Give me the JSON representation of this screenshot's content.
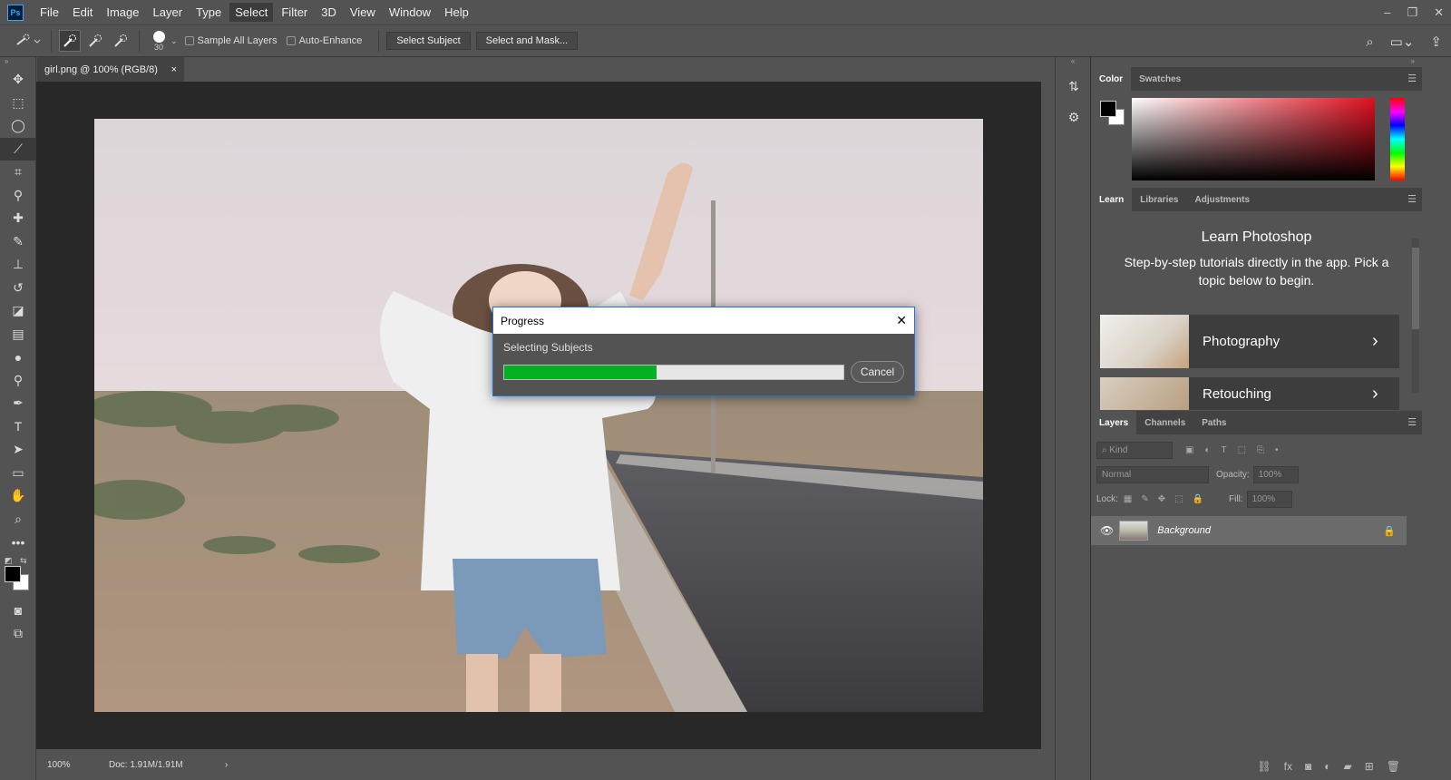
{
  "app": {
    "logo": "Ps"
  },
  "menu": [
    "File",
    "Edit",
    "Image",
    "Layer",
    "Type",
    "Select",
    "Filter",
    "3D",
    "View",
    "Window",
    "Help"
  ],
  "window_controls": {
    "minimize": "–",
    "restore": "❐",
    "close": "✕"
  },
  "options": {
    "brush_size": "30",
    "sample_all_layers": "Sample All Layers",
    "auto_enhance": "Auto-Enhance",
    "select_subject": "Select Subject",
    "select_and_mask": "Select and Mask..."
  },
  "document": {
    "tab_title": "girl.png @ 100% (RGB/8)",
    "tab_close": "×",
    "zoom": "100%",
    "doc_size": "Doc: 1.91M/1.91M"
  },
  "dialog": {
    "title": "Progress",
    "close": "✕",
    "message": "Selecting Subjects",
    "progress": 0.45,
    "cancel": "Cancel"
  },
  "color_panel": {
    "tabs": [
      "Color",
      "Swatches"
    ],
    "foreground": "#000000",
    "background": "#ffffff"
  },
  "learn_panel": {
    "tabs": [
      "Learn",
      "Libraries",
      "Adjustments"
    ],
    "title": "Learn Photoshop",
    "subtitle": "Step-by-step tutorials directly in the app. Pick a topic below to begin.",
    "cards": [
      "Photography",
      "Retouching"
    ]
  },
  "layers_panel": {
    "tabs": [
      "Layers",
      "Channels",
      "Paths"
    ],
    "kind": "Kind",
    "blend_mode": "Normal",
    "opacity_label": "Opacity:",
    "opacity": "100%",
    "lock_label": "Lock:",
    "fill_label": "Fill:",
    "fill": "100%",
    "layer_name": "Background"
  },
  "colors": {
    "progress_fill": "#06b025",
    "dialog_border": "#1a73e8"
  }
}
